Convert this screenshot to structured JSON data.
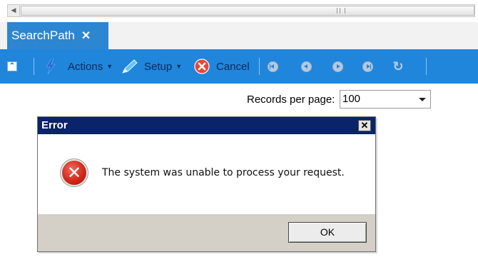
{
  "scrollbar": {
    "left_arrow": "◀"
  },
  "tab": {
    "label": "SearchPath",
    "close": "✕"
  },
  "toolbar": {
    "collapse_glyph": "⌃",
    "actions_label": "Actions",
    "setup_label": "Setup",
    "cancel_label": "Cancel",
    "caret": "▼",
    "refresh_glyph": "↻",
    "bg_color": "#1f86dc"
  },
  "records": {
    "label": "Records per page:",
    "value": "100"
  },
  "dialog": {
    "title": "Error",
    "close_glyph": "✕",
    "message": "The system was unable to process your request.",
    "ok_label": "OK",
    "error_glyph": "✕"
  }
}
